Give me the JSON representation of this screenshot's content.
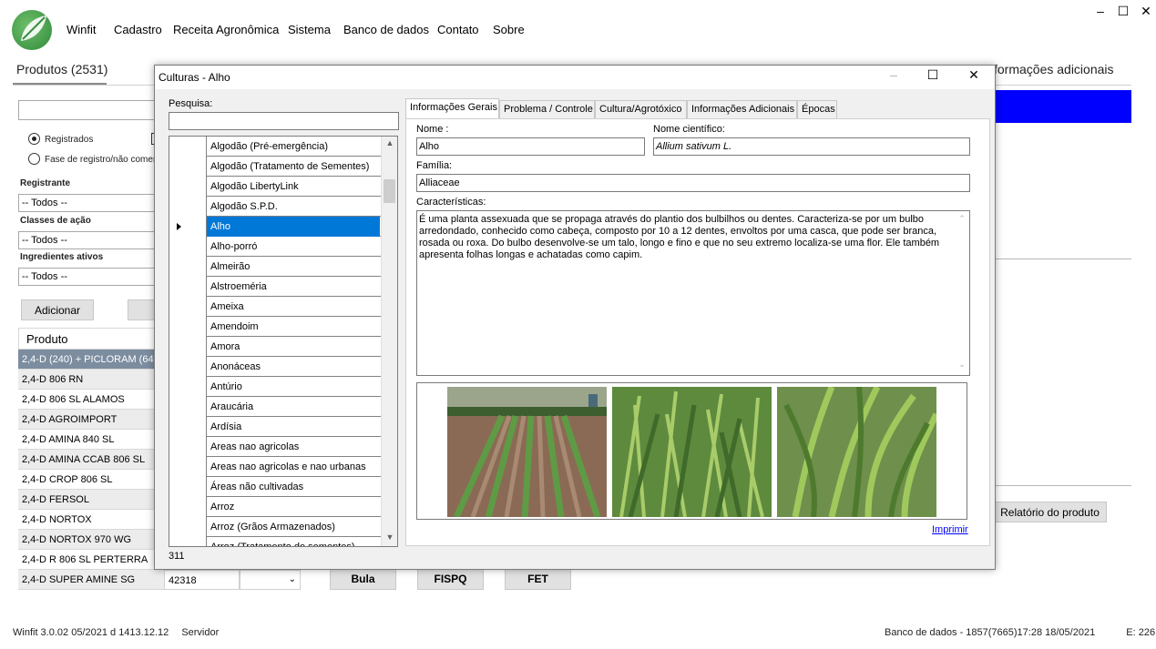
{
  "menu": {
    "items": [
      "Winfit",
      "Cadastro",
      "Receita Agronômica",
      "Sistema",
      "Banco de dados",
      "Contato",
      "Sobre"
    ]
  },
  "window_controls": {
    "minimize": "–",
    "maximize": "☐",
    "close": "✕"
  },
  "main": {
    "tab_produtos": "Produtos (2531)",
    "tab_info_partial": "formações adicionais",
    "radio_registrados": "Registrados",
    "radio_fase": "Fase de registro/não comer",
    "registrante_label": "Registrante",
    "registrante_value": "-- Todos --",
    "classes_label": "Classes de ação",
    "classes_value": "-- Todos --",
    "ingredientes_label": "Ingredientes ativos",
    "ingredientes_value": "-- Todos --",
    "adicionar_button": "Adicionar",
    "table_header": "Produto",
    "products": [
      "2,4-D (240) + PICLORAM (64...",
      "2,4-D 806 RN",
      "2,4-D 806 SL ALAMOS",
      "2,4-D AGROIMPORT",
      "2,4-D AMINA 840 SL",
      "2,4-D AMINA CCAB 806 SL",
      "2,4-D CROP 806 SL",
      "2,4-D FERSOL",
      "2,4-D NORTOX",
      "2,4-D NORTOX 970 WG",
      "2,4-D R 806 SL PERTERRA",
      "2,4-D SUPER AMINE SG"
    ],
    "last_row_code": "42318",
    "bula_button": "Bula",
    "fispq_button": "FISPQ",
    "fet_button": "FET",
    "relatorio_button": "Relatório do produto"
  },
  "status": {
    "version": "Winfit 3.0.02 05/2021 d 1413.12.12",
    "server": "Servidor",
    "db": "Banco de dados - 1857(7665)17:28 18/05/2021",
    "e": "E: 226"
  },
  "dialog": {
    "title": "Culturas - Alho",
    "pesquisa_label": "Pesquisa:",
    "pesquisa_value": "",
    "cultures": [
      "Algodão (Pré-emergência)",
      "Algodão (Tratamento de Sementes)",
      "Algodão LibertyLink",
      "Algodão S.P.D.",
      "Alho",
      "Alho-porró",
      "Almeirão",
      "Alstroeméria",
      "Ameixa",
      "Amendoim",
      "Amora",
      "Anonáceas",
      "Antúrio",
      "Araucária",
      "Ardísia",
      "Areas nao agricolas",
      "Areas nao agricolas e nao urbanas",
      "Áreas não cultivadas",
      "Arroz",
      "Arroz (Grãos Armazenados)",
      "Arroz (Tratamento de sementes)"
    ],
    "selected_index": 4,
    "count": "311",
    "tabs": [
      "Informações Gerais",
      "Problema / Controle",
      "Cultura/Agrotóxico",
      "Informações Adicionais",
      "Épocas"
    ],
    "nome_label": "Nome :",
    "nome_value": "Alho",
    "cientifico_label": "Nome científico:",
    "cientifico_value": "Allium sativum L.",
    "familia_label": "Família:",
    "familia_value": "Alliaceae",
    "caracteristicas_label": "Características:",
    "caracteristicas_value": "É uma planta assexuada que se propaga através do plantio dos bulbilhos ou dentes. Caracteriza-se por um bulbo arredondado, conhecido como cabeça, composto por 10 a 12 dentes, envoltos por uma casca, que pode ser branca, rosada ou roxa. Do bulbo desenvolve-se um talo, longo e fino e que no seu extremo localiza-se uma flor. Ele também apresenta folhas longas e achatadas como capim.",
    "imprimir": "Imprimir"
  },
  "colors": {
    "accent_blue": "#0000ff",
    "selection": "#0078d7",
    "selected_product": "#7d8da0"
  }
}
